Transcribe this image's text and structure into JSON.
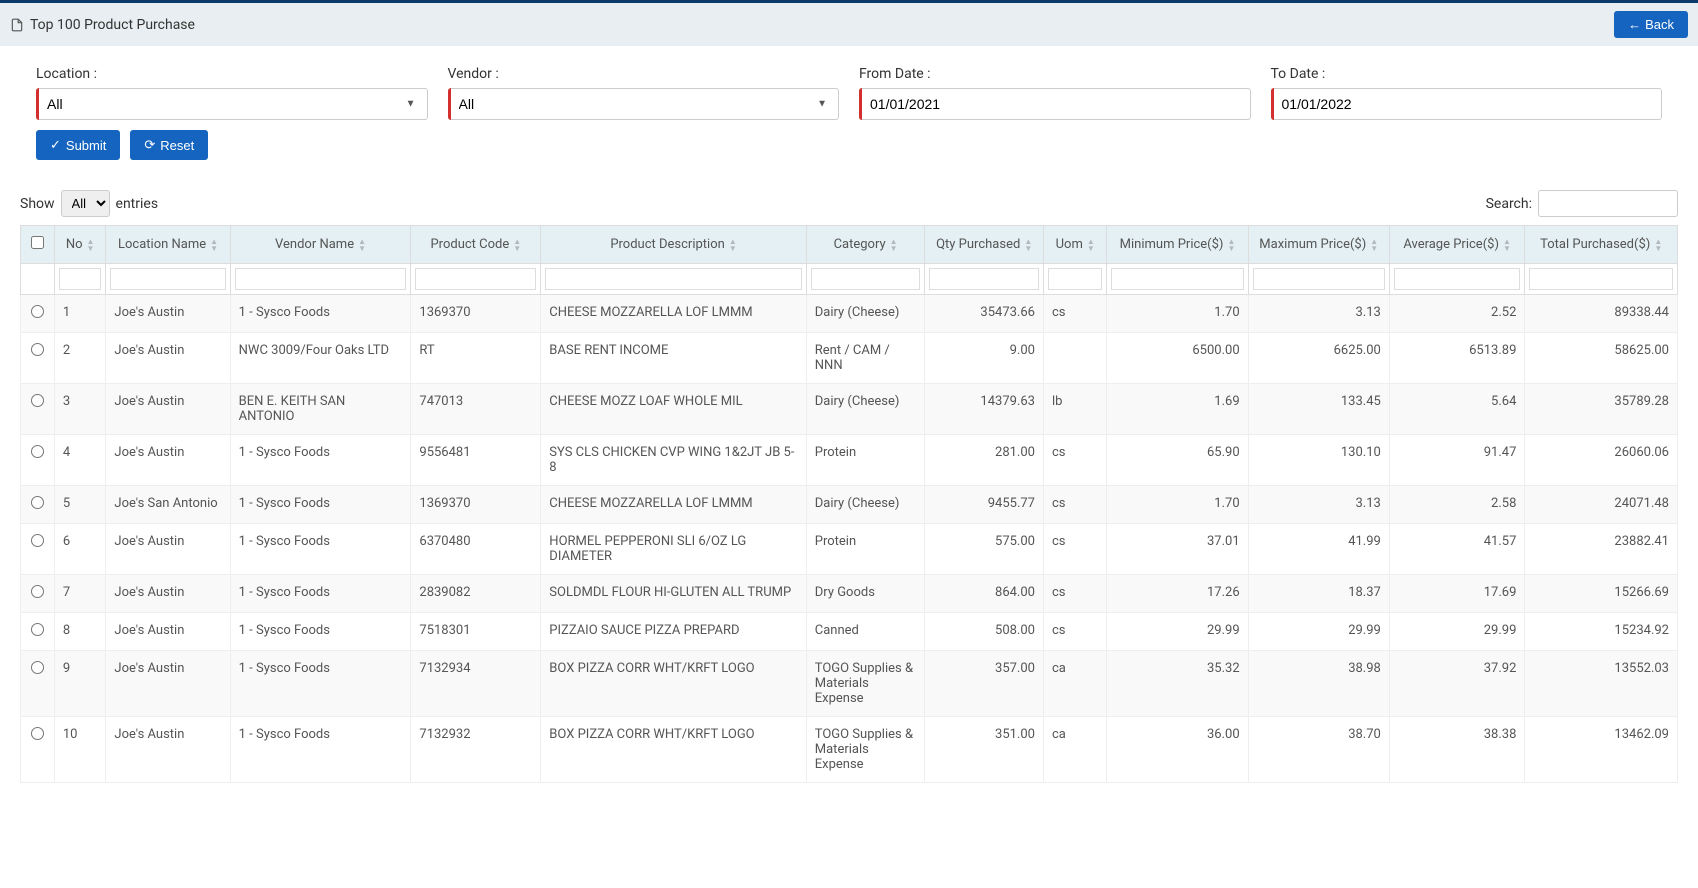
{
  "header": {
    "title": "Top 100 Product Purchase",
    "back": "Back"
  },
  "filters": {
    "location": {
      "label": "Location :",
      "value": "All"
    },
    "vendor": {
      "label": "Vendor :",
      "value": "All"
    },
    "fromDate": {
      "label": "From Date :",
      "value": "01/01/2021"
    },
    "toDate": {
      "label": "To Date :",
      "value": "01/01/2022"
    }
  },
  "actions": {
    "submit": "Submit",
    "reset": "Reset"
  },
  "tableControls": {
    "show": "Show",
    "entries": "entries",
    "showValue": "All",
    "search": "Search:"
  },
  "columns": [
    "No",
    "Location Name",
    "Vendor Name",
    "Product Code",
    "Product Description",
    "Category",
    "Qty Purchased",
    "Uom",
    "Minimum Price($)",
    "Maximum Price($)",
    "Average Price($)",
    "Total Purchased($)"
  ],
  "rows": [
    {
      "no": "1",
      "location": "Joe's Austin",
      "vendor": "1 - Sysco Foods",
      "code": "1369370",
      "desc": "CHEESE MOZZARELLA LOF LMMM",
      "category": "Dairy (Cheese)",
      "qty": "35473.66",
      "uom": "cs",
      "min": "1.70",
      "max": "3.13",
      "avg": "2.52",
      "total": "89338.44"
    },
    {
      "no": "2",
      "location": "Joe's Austin",
      "vendor": "NWC 3009/Four Oaks LTD",
      "code": "RT",
      "desc": "BASE RENT INCOME",
      "category": "Rent / CAM / NNN",
      "qty": "9.00",
      "uom": "",
      "min": "6500.00",
      "max": "6625.00",
      "avg": "6513.89",
      "total": "58625.00"
    },
    {
      "no": "3",
      "location": "Joe's Austin",
      "vendor": "BEN E. KEITH SAN ANTONIO",
      "code": "747013",
      "desc": "CHEESE MOZZ LOAF WHOLE MIL",
      "category": "Dairy (Cheese)",
      "qty": "14379.63",
      "uom": "lb",
      "min": "1.69",
      "max": "133.45",
      "avg": "5.64",
      "total": "35789.28"
    },
    {
      "no": "4",
      "location": "Joe's Austin",
      "vendor": "1 - Sysco Foods",
      "code": "9556481",
      "desc": "SYS CLS CHICKEN CVP WING 1&2JT JB 5-8",
      "category": "Protein",
      "qty": "281.00",
      "uom": "cs",
      "min": "65.90",
      "max": "130.10",
      "avg": "91.47",
      "total": "26060.06"
    },
    {
      "no": "5",
      "location": "Joe's San Antonio",
      "vendor": "1 - Sysco Foods",
      "code": "1369370",
      "desc": "CHEESE MOZZARELLA LOF LMMM",
      "category": "Dairy (Cheese)",
      "qty": "9455.77",
      "uom": "cs",
      "min": "1.70",
      "max": "3.13",
      "avg": "2.58",
      "total": "24071.48"
    },
    {
      "no": "6",
      "location": "Joe's Austin",
      "vendor": "1 - Sysco Foods",
      "code": "6370480",
      "desc": "HORMEL PEPPERONI SLI 6/OZ LG DIAMETER",
      "category": "Protein",
      "qty": "575.00",
      "uom": "cs",
      "min": "37.01",
      "max": "41.99",
      "avg": "41.57",
      "total": "23882.41"
    },
    {
      "no": "7",
      "location": "Joe's Austin",
      "vendor": "1 - Sysco Foods",
      "code": "2839082",
      "desc": "SOLDMDL FLOUR HI-GLUTEN ALL TRUMP",
      "category": "Dry Goods",
      "qty": "864.00",
      "uom": "cs",
      "min": "17.26",
      "max": "18.37",
      "avg": "17.69",
      "total": "15266.69"
    },
    {
      "no": "8",
      "location": "Joe's Austin",
      "vendor": "1 - Sysco Foods",
      "code": "7518301",
      "desc": "PIZZAIO SAUCE PIZZA PREPARD",
      "category": "Canned",
      "qty": "508.00",
      "uom": "cs",
      "min": "29.99",
      "max": "29.99",
      "avg": "29.99",
      "total": "15234.92"
    },
    {
      "no": "9",
      "location": "Joe's Austin",
      "vendor": "1 - Sysco Foods",
      "code": "7132934",
      "desc": "BOX PIZZA CORR WHT/KRFT LOGO",
      "category": "TOGO Supplies & Materials Expense",
      "qty": "357.00",
      "uom": "ca",
      "min": "35.32",
      "max": "38.98",
      "avg": "37.92",
      "total": "13552.03"
    },
    {
      "no": "10",
      "location": "Joe's Austin",
      "vendor": "1 - Sysco Foods",
      "code": "7132932",
      "desc": "BOX PIZZA CORR WHT/KRFT LOGO",
      "category": "TOGO Supplies & Materials Expense",
      "qty": "351.00",
      "uom": "ca",
      "min": "36.00",
      "max": "38.70",
      "avg": "38.38",
      "total": "13462.09"
    }
  ]
}
